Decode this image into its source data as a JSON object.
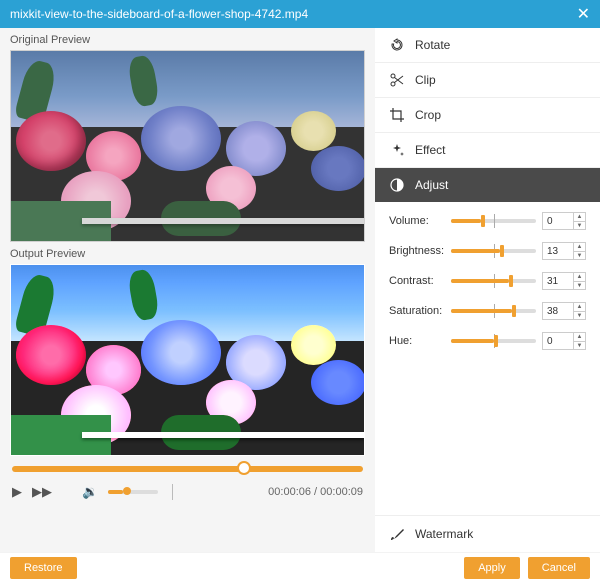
{
  "titlebar": {
    "filename": "mixkit-view-to-the-sideboard-of-a-flower-shop-4742.mp4"
  },
  "preview": {
    "original_label": "Original Preview",
    "output_label": "Output Preview"
  },
  "playback": {
    "current_time": "00:00:06",
    "total_time": "00:00:09",
    "separator": " / "
  },
  "menu": {
    "rotate": "Rotate",
    "clip": "Clip",
    "crop": "Crop",
    "effect": "Effect",
    "adjust": "Adjust",
    "watermark": "Watermark"
  },
  "adjust": {
    "labels": {
      "volume": "Volume:",
      "brightness": "Brightness:",
      "contrast": "Contrast:",
      "saturation": "Saturation:",
      "hue": "Hue:"
    },
    "values": {
      "volume": "0",
      "brightness": "13",
      "contrast": "31",
      "saturation": "38",
      "hue": "0"
    }
  },
  "buttons": {
    "restore": "Restore",
    "apply": "Apply",
    "cancel": "Cancel"
  }
}
